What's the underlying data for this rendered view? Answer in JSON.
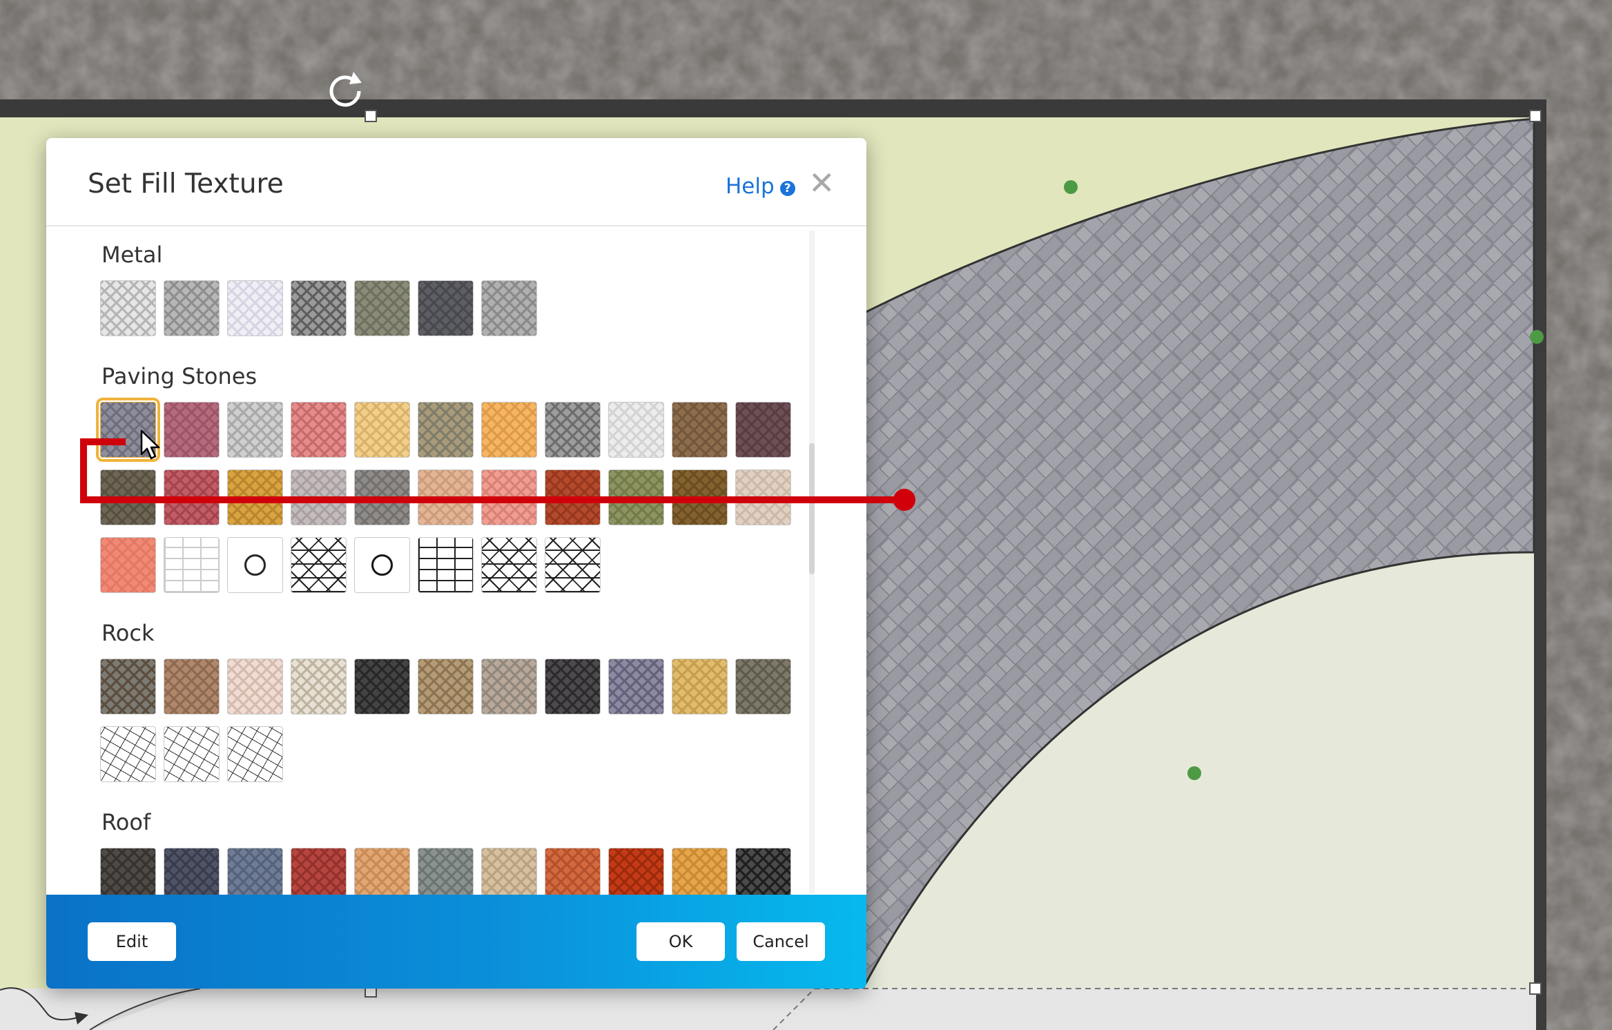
{
  "dialog": {
    "title": "Set Fill Texture",
    "help_label": "Help",
    "help_icon": "help-circle-icon",
    "close_icon": "close-icon"
  },
  "sections": [
    {
      "title": "Metal",
      "rows": [
        [
          {
            "name": "metal-1",
            "colors": [
              "#e6e6e6",
              "#b5b5b5"
            ]
          },
          {
            "name": "metal-2",
            "colors": [
              "#b7b7b7",
              "#8e8e8e"
            ]
          },
          {
            "name": "metal-3",
            "colors": [
              "#f0eff6",
              "#d6d5e3"
            ]
          },
          {
            "name": "metal-4",
            "colors": [
              "#9a9a9a",
              "#5e5e5e"
            ]
          },
          {
            "name": "metal-5",
            "colors": [
              "#8b8b78",
              "#6e7060"
            ]
          },
          {
            "name": "metal-6",
            "colors": [
              "#5d5d64",
              "#48484e"
            ]
          },
          {
            "name": "metal-7",
            "colors": [
              "#b0b0b0",
              "#8a8a8a"
            ]
          }
        ]
      ]
    },
    {
      "title": "Paving Stones",
      "rows": [
        [
          {
            "name": "paving-1",
            "colors": [
              "#8d8d9b",
              "#6f6f7c"
            ],
            "selected": true
          },
          {
            "name": "paving-2",
            "colors": [
              "#b56b7e",
              "#9d5467"
            ]
          },
          {
            "name": "paving-3",
            "colors": [
              "#cfcfcf",
              "#a9a9a9"
            ]
          },
          {
            "name": "paving-4",
            "colors": [
              "#e48c8c",
              "#c66a6a"
            ]
          },
          {
            "name": "paving-5",
            "colors": [
              "#f1cf8a",
              "#d9b26a"
            ]
          },
          {
            "name": "paving-6",
            "colors": [
              "#a99b7a",
              "#7f7d6a"
            ]
          },
          {
            "name": "paving-7",
            "colors": [
              "#f5b563",
              "#de9a4a"
            ]
          },
          {
            "name": "paving-8",
            "colors": [
              "#9d9d9d",
              "#6d6d6d"
            ]
          },
          {
            "name": "paving-9",
            "colors": [
              "#ececec",
              "#d3d3d3"
            ]
          },
          {
            "name": "paving-10",
            "colors": [
              "#8e6d4d",
              "#73573b"
            ]
          },
          {
            "name": "paving-11",
            "colors": [
              "#6d4f55",
              "#573d42"
            ]
          }
        ],
        [
          {
            "name": "paving-12",
            "colors": [
              "#6e6557",
              "#57503f"
            ]
          },
          {
            "name": "paving-13",
            "colors": [
              "#c25c66",
              "#a4444d"
            ]
          },
          {
            "name": "paving-14",
            "colors": [
              "#d9a341",
              "#b9862d"
            ]
          },
          {
            "name": "paving-15",
            "colors": [
              "#c4bcbc",
              "#a8a0a0"
            ]
          },
          {
            "name": "paving-16",
            "colors": [
              "#8f8b89",
              "#73706e"
            ]
          },
          {
            "name": "paving-17",
            "colors": [
              "#e2b597",
              "#cc9c7d"
            ]
          },
          {
            "name": "paving-18",
            "colors": [
              "#ef9e91",
              "#d98176"
            ]
          },
          {
            "name": "paving-19",
            "colors": [
              "#b44a2c",
              "#96381e"
            ]
          },
          {
            "name": "paving-20",
            "colors": [
              "#8d9461",
              "#747b4b"
            ]
          },
          {
            "name": "paving-21",
            "colors": [
              "#83622f",
              "#6b4d21"
            ]
          },
          {
            "name": "paving-22",
            "colors": [
              "#e2d1c3",
              "#cbb9aa"
            ]
          }
        ],
        [
          {
            "name": "paving-23",
            "colors": [
              "#f08a76",
              "#e47863"
            ]
          },
          {
            "name": "paving-24",
            "colors": [
              "#ffffff",
              "#cccccc"
            ],
            "pattern": "bricks"
          },
          {
            "name": "paving-25",
            "colors": [
              "#ffffff",
              "#222222"
            ],
            "pattern": "hex"
          },
          {
            "name": "paving-26",
            "colors": [
              "#ffffff",
              "#222222"
            ],
            "pattern": "oct"
          },
          {
            "name": "paving-27",
            "colors": [
              "#ffffff",
              "#111111"
            ],
            "pattern": "hex"
          },
          {
            "name": "paving-28",
            "colors": [
              "#ffffff",
              "#222222"
            ],
            "pattern": "bricks"
          },
          {
            "name": "paving-29",
            "colors": [
              "#ffffff",
              "#222222"
            ],
            "pattern": "oct"
          },
          {
            "name": "paving-30",
            "colors": [
              "#ffffff",
              "#222222"
            ],
            "pattern": "oct"
          }
        ]
      ]
    },
    {
      "title": "Rock",
      "rows": [
        [
          {
            "name": "rock-1",
            "colors": [
              "#7b7a73",
              "#5c4d3d"
            ]
          },
          {
            "name": "rock-2",
            "colors": [
              "#b0876a",
              "#8d6a52"
            ]
          },
          {
            "name": "rock-3",
            "colors": [
              "#f0dcd2",
              "#d4bbae"
            ]
          },
          {
            "name": "rock-4",
            "colors": [
              "#e8e0d2",
              "#bdb3a0"
            ]
          },
          {
            "name": "rock-5",
            "colors": [
              "#434343",
              "#282828"
            ]
          },
          {
            "name": "rock-6",
            "colors": [
              "#b59b75",
              "#8b7453"
            ]
          },
          {
            "name": "rock-7",
            "colors": [
              "#b8a89a",
              "#90877d"
            ]
          },
          {
            "name": "rock-8",
            "colors": [
              "#4d4a4e",
              "#2d2a2e"
            ]
          },
          {
            "name": "rock-9",
            "colors": [
              "#8b8aa0",
              "#63627a"
            ]
          },
          {
            "name": "rock-10",
            "colors": [
              "#e0bc6b",
              "#c59f4f"
            ]
          },
          {
            "name": "rock-11",
            "colors": [
              "#7e786a",
              "#5e5a4e"
            ]
          }
        ],
        [
          {
            "name": "rock-12",
            "colors": [
              "#ffffff",
              "#333333"
            ],
            "pattern": "stones"
          },
          {
            "name": "rock-13",
            "colors": [
              "#ffffff",
              "#333333"
            ],
            "pattern": "stones"
          },
          {
            "name": "rock-14",
            "colors": [
              "#ffffff",
              "#333333"
            ],
            "pattern": "stones"
          }
        ]
      ]
    },
    {
      "title": "Roof",
      "rows": [
        [
          {
            "name": "roof-1",
            "colors": [
              "#4e4b47",
              "#35322f"
            ]
          },
          {
            "name": "roof-2",
            "colors": [
              "#4f5366",
              "#393c4c"
            ]
          },
          {
            "name": "roof-3",
            "colors": [
              "#6e7c96",
              "#56627a"
            ]
          },
          {
            "name": "roof-4",
            "colors": [
              "#b5453e",
              "#93312c"
            ]
          },
          {
            "name": "roof-5",
            "colors": [
              "#e1a772",
              "#c88a56"
            ]
          },
          {
            "name": "roof-6",
            "colors": [
              "#8a9290",
              "#6c7472"
            ]
          },
          {
            "name": "roof-7",
            "colors": [
              "#d6c0a0",
              "#b9a282"
            ]
          },
          {
            "name": "roof-8",
            "colors": [
              "#d3693f",
              "#b5512b"
            ]
          },
          {
            "name": "roof-9",
            "colors": [
              "#c53a16",
              "#9c2a0c"
            ]
          },
          {
            "name": "roof-10",
            "colors": [
              "#e7a54a",
              "#c98a33"
            ]
          },
          {
            "name": "roof-11",
            "colors": [
              "#4a4a4a",
              "#1e1e1e"
            ]
          }
        ]
      ]
    }
  ],
  "footer": {
    "edit_label": "Edit",
    "ok_label": "OK",
    "cancel_label": "Cancel"
  },
  "colors": {
    "accent": "#1a73d9",
    "footer_gradient_start": "#0a72c7",
    "footer_gradient_end": "#06b9ee",
    "selection": "#f0b33a",
    "annotation_red": "#d0000b",
    "lawn": "#e2e6bd",
    "paving_fill": "#9c9ca4"
  },
  "canvas": {
    "rotate_icon": "rotate-icon"
  }
}
